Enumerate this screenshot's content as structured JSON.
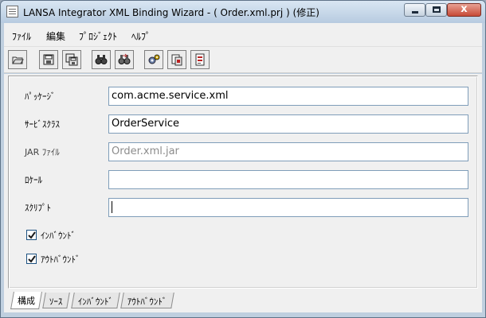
{
  "window": {
    "title": "LANSA Integrator XML Binding Wizard - ( Order.xml.prj ) (修正)",
    "close_glyph": "x"
  },
  "menu": [
    "ﾌｧｲﾙ",
    "編集",
    "ﾌﾟﾛｼﾞｪｸﾄ",
    "ﾍﾙﾌﾟ"
  ],
  "toolbar": {
    "buttons": [
      "open-folder-icon",
      "save-icon",
      "save-all-icon",
      "find-icon",
      "replace-icon",
      "settings-icon",
      "generate-icon",
      "build-icon"
    ]
  },
  "form": {
    "package_label": "ﾊﾟｯｹｰｼﾞ",
    "package_value": "com.acme.service.xml",
    "service_class_label": "ｻｰﾋﾞｽｸﾗｽ",
    "service_class_value": "OrderService",
    "jar_file_label": "JAR ﾌｧｲﾙ",
    "jar_file_value": "Order.xml.jar",
    "locale_label": "ﾛｹｰﾙ",
    "locale_value": "",
    "script_label": "ｽｸﾘﾌﾟﾄ",
    "script_value": "",
    "inbound_label": "ｲﾝﾊﾞｳﾝﾄﾞ",
    "inbound_checked": true,
    "outbound_label": "ｱｳﾄﾊﾞｳﾝﾄﾞ",
    "outbound_checked": true
  },
  "tabs": [
    "構成",
    "ｿｰｽ",
    "ｲﾝﾊﾞｳﾝﾄﾞ",
    "ｱｳﾄﾊﾞｳﾝﾄﾞ"
  ],
  "active_tab": "構成"
}
